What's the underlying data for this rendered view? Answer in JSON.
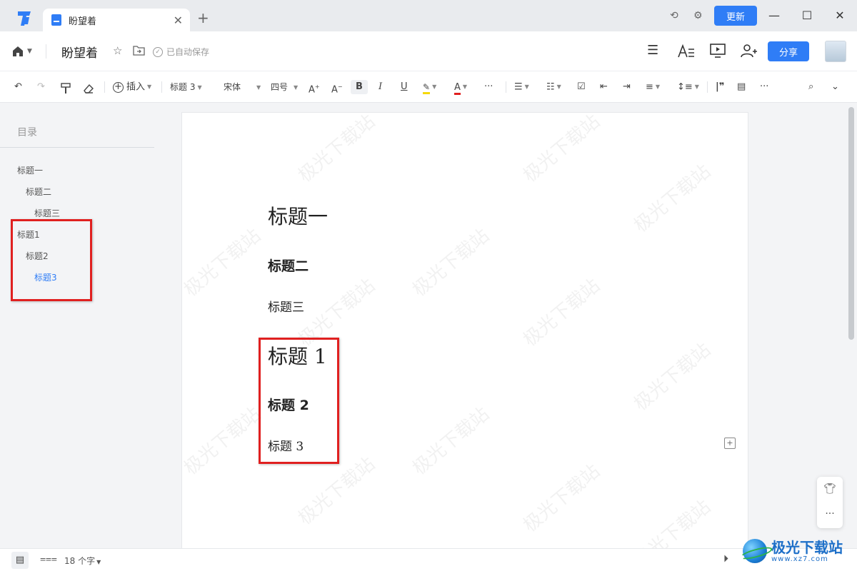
{
  "titlebar": {
    "tab_label": "盼望着",
    "close_symbol": "✕",
    "new_tab_symbol": "+",
    "update_label": "更新"
  },
  "header": {
    "doc_title": "盼望着",
    "saved_status": "已自动保存",
    "share_label": "分享"
  },
  "toolbar": {
    "insert_label": "插入",
    "heading_style": "标题 3",
    "font_name": "宋体",
    "font_size": "四号",
    "more": "···"
  },
  "sidebar": {
    "title": "目录",
    "items": [
      {
        "label": "标题一",
        "level": 1,
        "active": false
      },
      {
        "label": "标题二",
        "level": 2,
        "active": false
      },
      {
        "label": "标题三",
        "level": 3,
        "active": false
      },
      {
        "label": "标题1",
        "level": 1,
        "active": false
      },
      {
        "label": "标题2",
        "level": 2,
        "active": false
      },
      {
        "label": "标题3",
        "level": 3,
        "active": true
      }
    ]
  },
  "document": {
    "headings": [
      {
        "text": "标题一",
        "level": 1
      },
      {
        "text": "标题二",
        "level": 2
      },
      {
        "text": "标题三",
        "level": 3
      },
      {
        "text": "标题 1",
        "level": 1
      },
      {
        "text": "标题 2",
        "level": 2
      },
      {
        "text": "标题 3",
        "level": 3
      }
    ],
    "watermark_text": "极光下载站"
  },
  "statusbar": {
    "word_count": "18 个字"
  },
  "site_logo": {
    "name": "极光下载站",
    "url": "www.xz7.com"
  },
  "colors": {
    "accent": "#2f7df6",
    "highlight_box": "#e02020"
  }
}
